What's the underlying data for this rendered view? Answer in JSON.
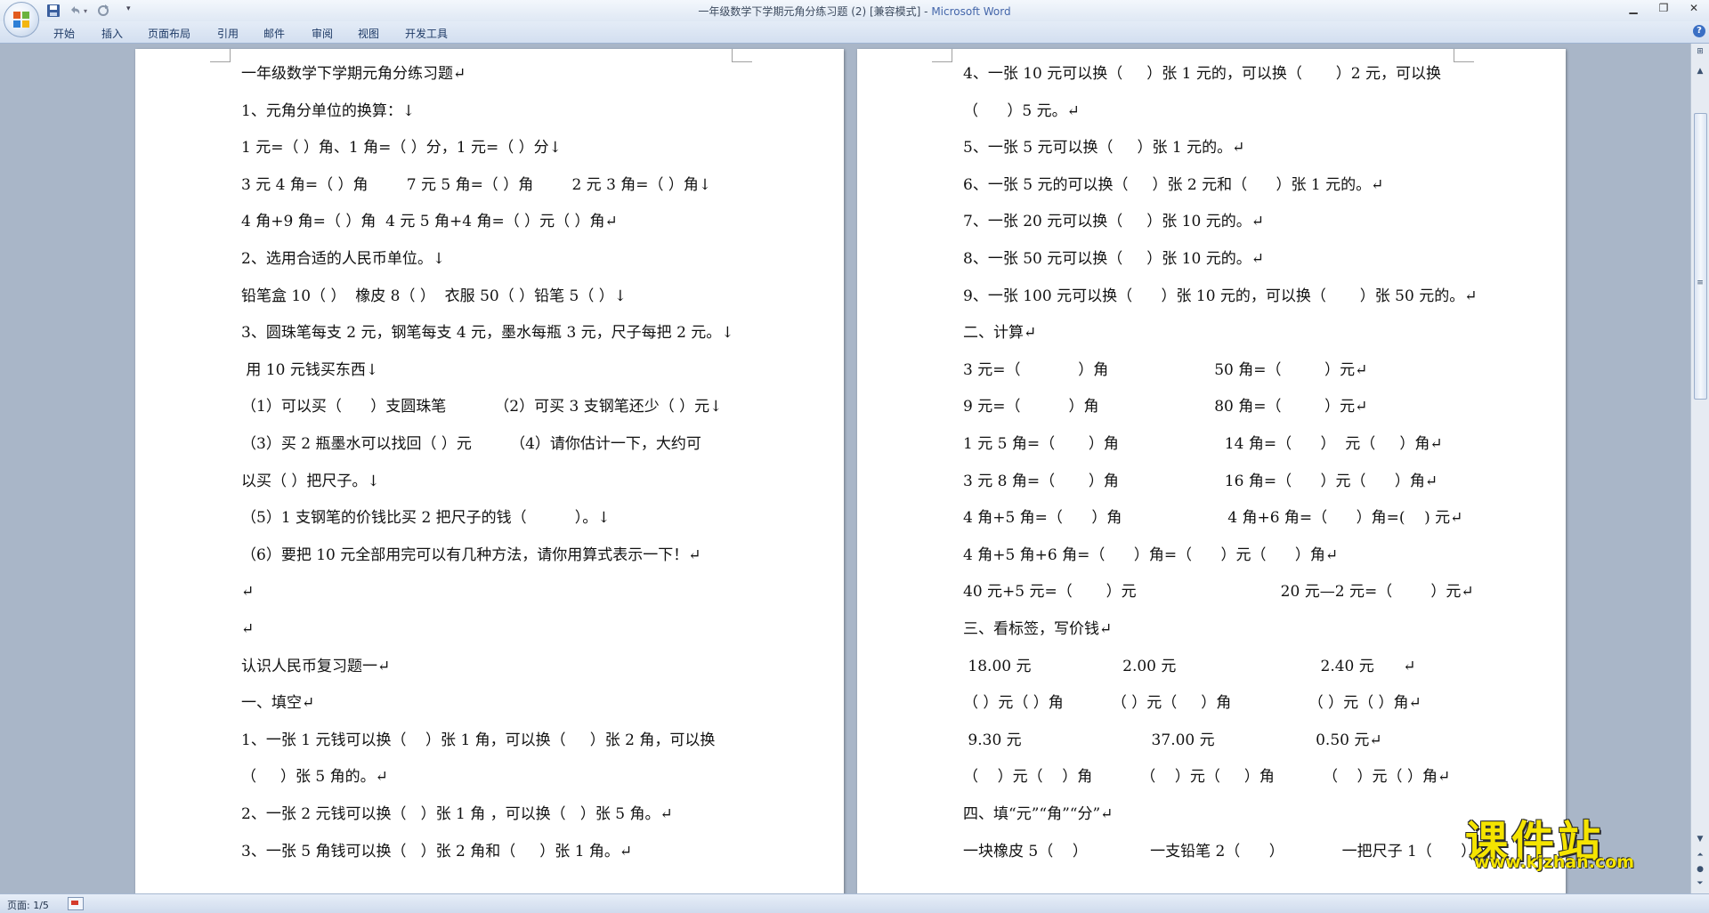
{
  "window": {
    "title": "一年级数学下学期元角分练习题 (2) [兼容模式] - ",
    "app_name": "Microsoft Word"
  },
  "ribbon": {
    "tabs": [
      "开始",
      "插入",
      "页面布局",
      "引用",
      "邮件",
      "审阅",
      "视图",
      "开发工具"
    ],
    "help": "?"
  },
  "page_left": {
    "lines": [
      "一年级数学下学期元角分练习题↵",
      "1、元角分单位的换算：↓",
      "1 元=（ ）角、1 角=（ ）分，1 元=（ ）分↓",
      "3 元 4 角=（ ）角        7 元 5 角=（ ）角        2 元 3 角=（ ）角↓",
      "4 角+9 角=（ ）角  4 元 5 角+4 角=（ ）元（ ）角↵",
      "2、选用合适的人民币单位。↓",
      "铅笔盒 10（ ）  橡皮 8（ ）  衣服 50（ ）铅笔 5（ ）↓",
      "3、圆珠笔每支 2 元，钢笔每支 4 元，墨水每瓶 3 元，尺子每把 2 元。↓",
      " 用 10 元钱买东西↓",
      "（1）可以买（      ）支圆珠笔          （2）可买 3 支钢笔还少（ ）元↓",
      "（3）买 2 瓶墨水可以找回（ ）元        （4）请你估计一下，大约可",
      "以买（ ）把尺子。↓",
      "（5）1 支钢笔的价钱比买 2 把尺子的钱（          ）。↓",
      "（6）要把 10 元全部用完可以有几种方法，请你用算式表示一下！↵",
      "↵",
      "↵",
      "认识人民币复习题一↵",
      "一、填空↵",
      "1、一张 1 元钱可以换（    ）张 1 角，可以换（     ）张 2 角，可以换",
      "（     ）张 5 角的。↵",
      "2、一张 2 元钱可以换（   ）张 1 角 ，可以换（   ）张 5 角。↵",
      "3、一张 5 角钱可以换（   ）张 2 角和（     ）张 1 角。↵"
    ]
  },
  "page_right": {
    "lines": [
      "4、一张 10 元可以换（     ）张 1 元的，可以换（       ）2 元，可以换",
      "（      ）5 元。↵",
      "5、一张 5 元可以换（     ）张 1 元的。↵",
      "6、一张 5 元的可以换（     ）张 2 元和（      ）张 1 元的。↵",
      "7、一张 20 元可以换（     ）张 10 元的。↵",
      "8、一张 50 元可以换（     ）张 10 元的。↵",
      "9、一张 100 元可以换（      ）张 10 元的，可以换（       ）张 50 元的。↵",
      "二、计算↵",
      "3 元=（            ）角                      50 角=（         ）元↵",
      "9 元=（          ）角                        80 角=（         ）元↵",
      "1 元 5 角=（       ）角                      14 角=（      ）  元（     ）角↵",
      "3 元 8 角=（       ）角                      16 角=（      ）元（      ）角↵",
      "4 角+5 角=（      ）角                      4 角+6 角=（      ）角=(    ) 元↵",
      "4 角+5 角+6 角=（      ）角=（      ）元（      ）角↵",
      "40 元+5 元=（       ）元                              20 元—2 元=（        ）元↵",
      "三、看标签，写价钱↵",
      " 18.00 元                   2.00 元                              2.40 元      ↵",
      "（ ）元（ ）角          （ ）元（     ）角                （ ）元（ ）角↵",
      " 9.30 元                           37.00 元                     0.50 元↵",
      "（    ）元（    ）角          （    ）元（     ）角          （    ）元（ ）角↵",
      "四、填“元”“角”“分”↵",
      "一块橡皮 5（    ）             一支铅笔 2（      ）            一把尺子 1（      ）↵"
    ]
  },
  "statusbar": {
    "page_info": "页面: 1/5"
  },
  "watermark": {
    "title": "课件站",
    "url": "www.kjzhan.com"
  },
  "colors": {
    "workspace": "#a9b6c8",
    "ribbon": "#dfe8f4",
    "title_app": "#4466aa",
    "watermark": "#f5e400"
  }
}
